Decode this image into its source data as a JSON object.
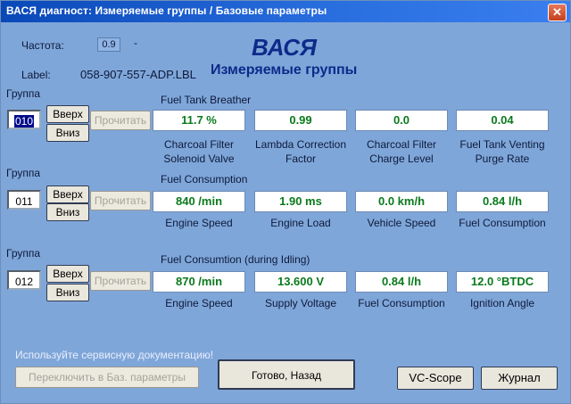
{
  "window": {
    "title": "ВАСЯ диагност: Измеряемые группы / Базовые параметры",
    "close_glyph": "✕"
  },
  "header": {
    "freq_label": "Частота:",
    "freq_value": "0.9",
    "freq_dash": "-",
    "label_caption": "Label:",
    "label_value": "058-907-557-ADP.LBL",
    "app_name": "ВАСЯ",
    "subtitle": "Измеряемые группы"
  },
  "group_caption": "Группа",
  "buttons": {
    "up": "Вверх",
    "down": "Вниз",
    "read": "Прочитать"
  },
  "groups": [
    {
      "number": "010",
      "section": "Fuel Tank Breather",
      "values": [
        "11.7 %",
        "0.99",
        "0.0",
        "0.04"
      ],
      "captions": [
        [
          "Charcoal Filter",
          "Solenoid Valve"
        ],
        [
          "Lambda Correction",
          "Factor"
        ],
        [
          "Charcoal Filter",
          "Charge Level"
        ],
        [
          "Fuel Tank Venting",
          "Purge Rate"
        ]
      ]
    },
    {
      "number": "011",
      "section": "Fuel Consumption",
      "values": [
        "840 /min",
        "1.90 ms",
        "0.0 km/h",
        "0.84 l/h"
      ],
      "captions": [
        [
          "Engine Speed"
        ],
        [
          "Engine Load"
        ],
        [
          "Vehicle Speed"
        ],
        [
          "Fuel Consumption"
        ]
      ]
    },
    {
      "number": "012",
      "section": "Fuel Consumtion (during Idling)",
      "values": [
        "870 /min",
        "13.600 V",
        "0.84 l/h",
        "12.0 °BTDC"
      ],
      "captions": [
        [
          "Engine Speed"
        ],
        [
          "Supply Voltage"
        ],
        [
          "Fuel Consumption"
        ],
        [
          "Ignition Angle"
        ]
      ]
    }
  ],
  "footer": {
    "note": "Используйте сервисную документацию!",
    "switch_button": "Переключить в Баз. параметры",
    "done_button": "Готово, Назад",
    "vcscope_button": "VC-Scope",
    "journal_button": "Журнал"
  }
}
